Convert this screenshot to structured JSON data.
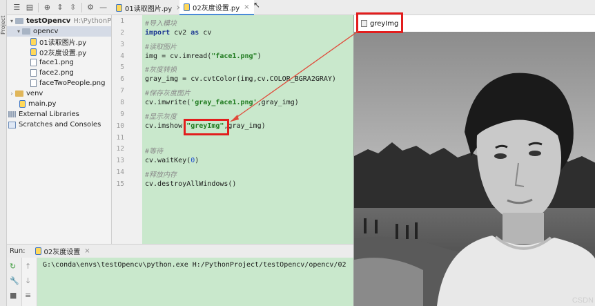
{
  "side_stripe": {
    "label": "Project"
  },
  "project": {
    "root_name": "testOpencv",
    "root_path": "H:\\PythonProject",
    "items": [
      {
        "label": "opencv"
      },
      {
        "label": "01读取图片.py"
      },
      {
        "label": "02灰度设置.py"
      },
      {
        "label": "face1.png"
      },
      {
        "label": "face2.png"
      },
      {
        "label": "faceTwoPeople.png"
      },
      {
        "label": "venv"
      },
      {
        "label": "main.py"
      },
      {
        "label": "External Libraries"
      },
      {
        "label": "Scratches and Consoles"
      }
    ]
  },
  "editor": {
    "tabs": [
      {
        "label": "01读取图片.py"
      },
      {
        "label": "02灰度设置.py"
      }
    ],
    "lines": [
      {
        "num": "1",
        "text": "#导入模块"
      },
      {
        "num": "2",
        "kw": "import",
        "mid": " cv2 ",
        "kw2": "as",
        "rest": " cv"
      },
      {
        "num": "3",
        "text": "#读取图片"
      },
      {
        "num": "4",
        "pre": "img = cv.imread(",
        "str": "\"face1.png\"",
        "post": ")"
      },
      {
        "num": "5",
        "text": "#灰度转换"
      },
      {
        "num": "6",
        "text": "gray_img = cv.cvtColor(img,cv.COLOR_BGRA2GRAY)"
      },
      {
        "num": "7",
        "text": "#保存灰度图片"
      },
      {
        "num": "8",
        "pre": "cv.imwrite(",
        "str": "'gray_face1.png'",
        "post": ",gray_img)"
      },
      {
        "num": "9",
        "text": "#显示灰度"
      },
      {
        "num": "10",
        "pre": "cv.imshow(",
        "str": "\"greyImg\"",
        "post": ",gray_img)"
      },
      {
        "num": "11",
        "text": ""
      },
      {
        "num": "12",
        "text": "#等待"
      },
      {
        "num": "13",
        "pre": "cv.waitKey(",
        "numval": "0",
        "post": ")"
      },
      {
        "num": "14",
        "text": "#释放内存"
      },
      {
        "num": "15",
        "text": "cv.destroyAllWindows()"
      }
    ]
  },
  "image_window": {
    "title": "greyImg"
  },
  "run": {
    "label": "Run:",
    "tab": "02灰度设置",
    "output": "G:\\conda\\envs\\testOpencv\\python.exe H:/PythonProject/testOpencv/opencv/02"
  },
  "watermark": "CSDN",
  "colors": {
    "highlight": "#e21d1d",
    "code_bg": "#c9e8cc",
    "selection": "#d5dbe6"
  }
}
